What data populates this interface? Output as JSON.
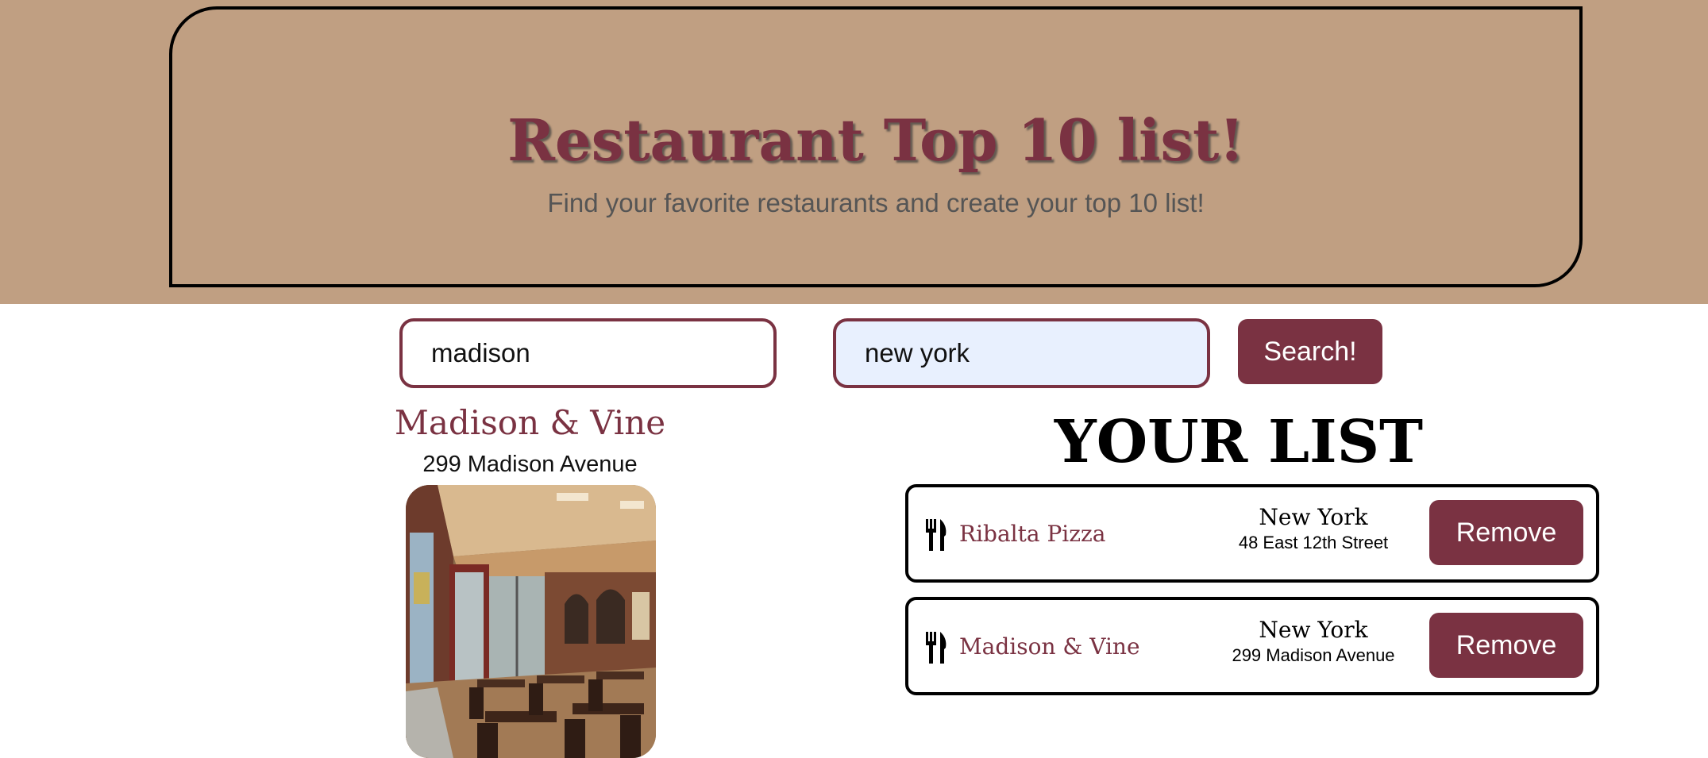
{
  "header": {
    "title": "Restaurant Top 10 list!",
    "subtitle": "Find your favorite restaurants and create your top 10 list!"
  },
  "search": {
    "term_value": "madison",
    "location_value": "new york",
    "button_label": "Search!"
  },
  "result": {
    "name": "Madison & Vine",
    "address": "299 Madison Avenue",
    "photo_icon": "restaurant-photo"
  },
  "list": {
    "title": "YOUR LIST",
    "items": [
      {
        "icon": "fork-knife-icon",
        "name": "Ribalta Pizza",
        "city": "New York",
        "address": "48 East 12th Street",
        "remove_label": "Remove"
      },
      {
        "icon": "fork-knife-icon",
        "name": "Madison & Vine",
        "city": "New York",
        "address": "299 Madison Avenue",
        "remove_label": "Remove"
      }
    ]
  },
  "colors": {
    "header_bg": "#c09f82",
    "accent": "#7a3242",
    "location_input_bg": "#e8f0fe"
  }
}
